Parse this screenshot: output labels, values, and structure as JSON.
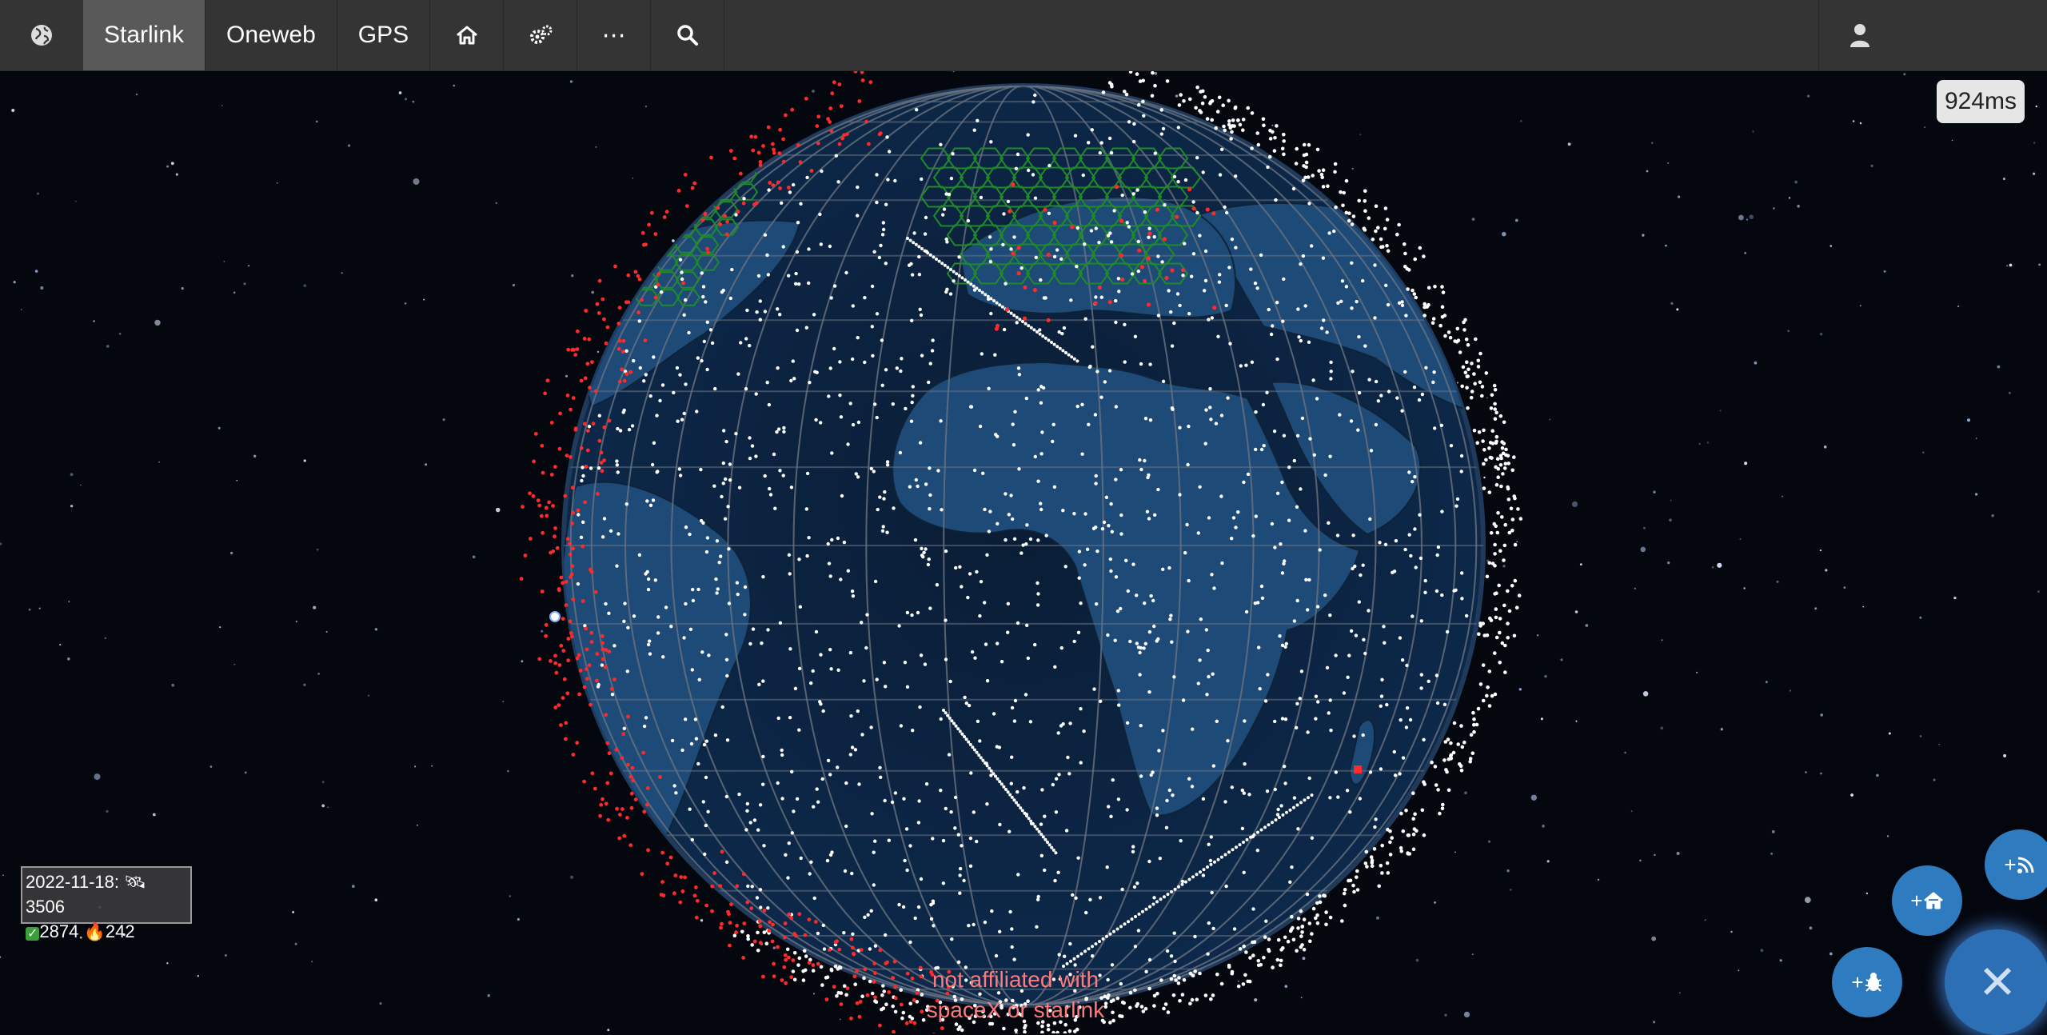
{
  "navbar": {
    "logo_icon": "globe-icon",
    "tabs": [
      {
        "label": "Starlink",
        "active": true
      },
      {
        "label": "Oneweb",
        "active": false
      },
      {
        "label": "GPS",
        "active": false
      }
    ],
    "icons": [
      "home-icon",
      "gears-icon",
      "more-icon",
      "search-icon"
    ],
    "more_label": "⋯",
    "user_icon": "user-icon"
  },
  "timing": "924ms",
  "stats": {
    "date": "2022-11-18:",
    "total_icon": "satellite-icon",
    "total": "3506",
    "active_icon": "check-icon",
    "active": "2874",
    "decayed_icon": "fire-icon",
    "decayed": "242"
  },
  "disclaimer": {
    "line1": "not affiliated with",
    "line2": "spaceX or starlink"
  },
  "fabs": {
    "add_feed": {
      "label": "+",
      "icon": "rss-icon"
    },
    "add_home": {
      "label": "+",
      "icon": "home-icon"
    },
    "add_bug": {
      "label": "+",
      "icon": "bug-icon"
    },
    "close": {
      "label": "✕",
      "icon": "close-icon"
    }
  },
  "colors": {
    "navbar": "#343434",
    "active_tab": "#595959",
    "ocean": "#0b1f3a",
    "land": "#1e4a78",
    "satellite_active": "#ffffff",
    "satellite_decayed": "#ff2a2a",
    "coverage_cell": "#1f8a2a",
    "fab": "#2f7bbf",
    "disclaimer": "#ff7b7b"
  }
}
